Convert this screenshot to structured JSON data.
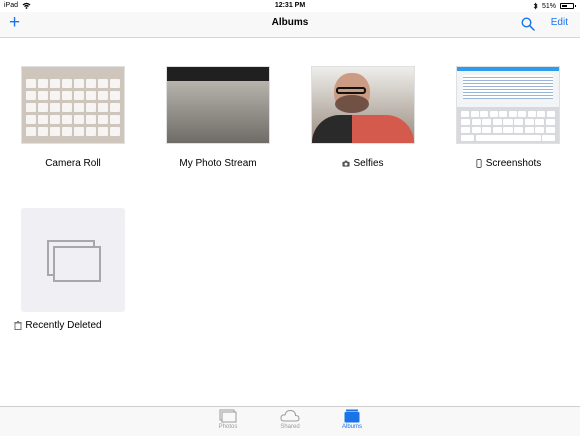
{
  "status": {
    "device": "iPad",
    "time": "12:31 PM",
    "battery": "51%",
    "battery_level": 0.51
  },
  "nav": {
    "title": "Albums",
    "add_icon": "plus-icon",
    "search_icon": "search-icon",
    "edit_label": "Edit"
  },
  "albums": [
    {
      "label": "Camera Roll",
      "icon": ""
    },
    {
      "label": "My Photo Stream",
      "icon": ""
    },
    {
      "label": "Selfies",
      "icon": "camera-icon"
    },
    {
      "label": "Screenshots",
      "icon": "phone-icon"
    },
    {
      "label": "Recently Deleted",
      "icon": "trash-icon"
    }
  ],
  "tabs": [
    {
      "label": "Photos",
      "icon": "photos-icon",
      "active": false
    },
    {
      "label": "Shared",
      "icon": "cloud-icon",
      "active": false
    },
    {
      "label": "Albums",
      "icon": "albums-icon",
      "active": true
    }
  ],
  "colors": {
    "accent": "#1a74e8",
    "tab_inactive": "#9b9b9b",
    "background": "#ffffff"
  }
}
